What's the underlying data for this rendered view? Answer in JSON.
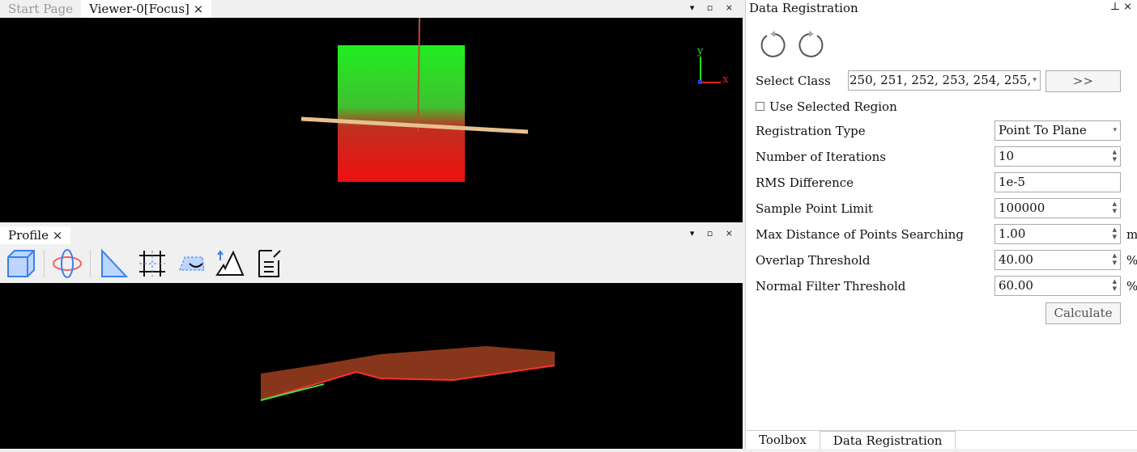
{
  "top_tabs": [
    {
      "label": "Start Page",
      "active": false
    },
    {
      "label": "Viewer-0[Focus]",
      "active": true
    }
  ],
  "close_glyph": "×",
  "window_controls": "▾ ▫ ×",
  "axes": {
    "y": "y",
    "x": "x"
  },
  "profile": {
    "tab_label": "Profile",
    "tools": [
      "box-select-icon",
      "orbit-icon",
      "measure-ruler-icon",
      "grid-section-icon",
      "hide-region-icon",
      "terrain-elevation-icon",
      "export-report-icon"
    ]
  },
  "panel": {
    "title": "Data Registration",
    "pin": "⊥ ×",
    "select_class_label": "Select Class",
    "select_class_value": "250, 251, 252, 253, 254, 255,",
    "more_button": ">>",
    "use_selected_region": "Use Selected Region",
    "use_selected_region_checked": false,
    "rows": [
      {
        "label": "Registration Type",
        "value": "Point To Plane",
        "kind": "combo",
        "unit": ""
      },
      {
        "label": "Number of Iterations",
        "value": "10",
        "kind": "spin",
        "unit": ""
      },
      {
        "label": "RMS Difference",
        "value": "1e-5",
        "kind": "text",
        "unit": ""
      },
      {
        "label": "Sample Point Limit",
        "value": "100000",
        "kind": "spin",
        "unit": ""
      },
      {
        "label": "Max Distance of Points Searching",
        "value": "1.00",
        "kind": "spin",
        "unit": "m"
      },
      {
        "label": "Overlap Threshold",
        "value": "40.00",
        "kind": "spin",
        "unit": "%"
      },
      {
        "label": "Normal Filter Threshold",
        "value": "60.00",
        "kind": "spin",
        "unit": "%"
      }
    ],
    "calculate": "Calculate",
    "bottom_tabs": [
      {
        "label": "Toolbox",
        "active": false
      },
      {
        "label": "Data Registration",
        "active": true
      }
    ]
  },
  "colors": {
    "ground": "#ff2020",
    "canopy": "#20ff20",
    "profile_line": "#e8c090"
  }
}
